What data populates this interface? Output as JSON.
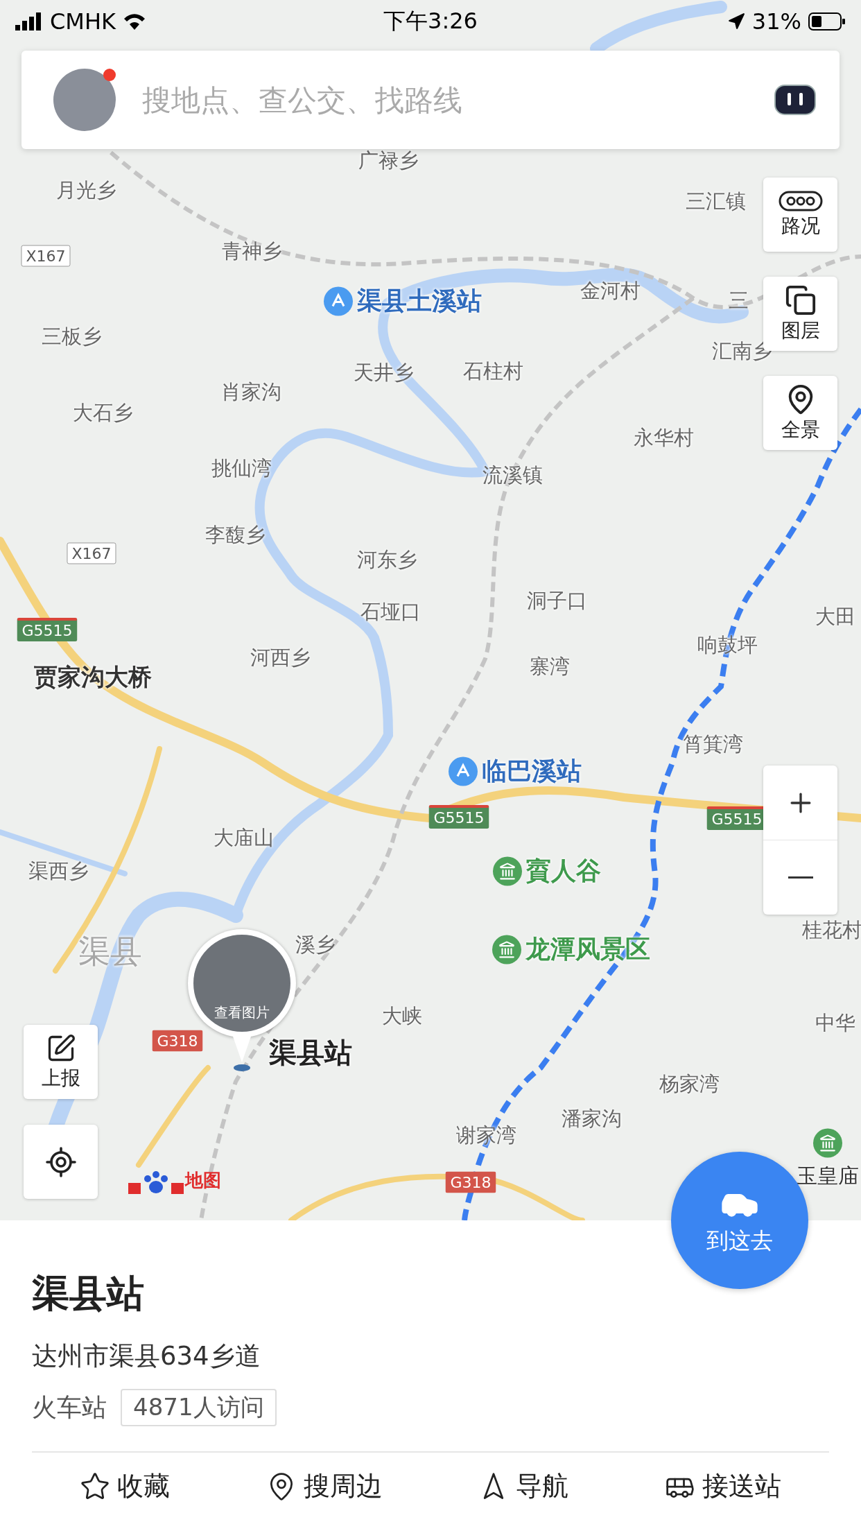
{
  "status_bar": {
    "carrier": "CMHK",
    "time": "下午3:26",
    "battery": "31%"
  },
  "search": {
    "placeholder": "搜地点、查公交、找路线",
    "badge": true
  },
  "map_labels": [
    {
      "text": "广禄乡",
      "kind": "place"
    },
    {
      "text": "月光乡",
      "kind": "place"
    },
    {
      "text": "三汇镇",
      "kind": "place"
    },
    {
      "text": "X167",
      "kind": "county_road"
    },
    {
      "text": "青神乡",
      "kind": "place"
    },
    {
      "text": "渠县土溪站",
      "kind": "station"
    },
    {
      "text": "金河村",
      "kind": "place"
    },
    {
      "text": "三",
      "kind": "place"
    },
    {
      "text": "汇南乡",
      "kind": "place"
    },
    {
      "text": "三板乡",
      "kind": "place"
    },
    {
      "text": "天井乡",
      "kind": "place"
    },
    {
      "text": "石柱村",
      "kind": "place"
    },
    {
      "text": "肖家沟",
      "kind": "place"
    },
    {
      "text": "大石乡",
      "kind": "place"
    },
    {
      "text": "永华村",
      "kind": "place"
    },
    {
      "text": "挑仙湾",
      "kind": "place"
    },
    {
      "text": "流溪镇",
      "kind": "place"
    },
    {
      "text": "李馥乡",
      "kind": "place"
    },
    {
      "text": "X167",
      "kind": "county_road"
    },
    {
      "text": "河东乡",
      "kind": "place"
    },
    {
      "text": "洞子口",
      "kind": "place"
    },
    {
      "text": "石垭口",
      "kind": "place"
    },
    {
      "text": "大田",
      "kind": "place"
    },
    {
      "text": "G5515",
      "kind": "expressway"
    },
    {
      "text": "响鼓坪",
      "kind": "place"
    },
    {
      "text": "河西乡",
      "kind": "place"
    },
    {
      "text": "寨湾",
      "kind": "place"
    },
    {
      "text": "贾家沟大桥",
      "kind": "landmark"
    },
    {
      "text": "筲箕湾",
      "kind": "place"
    },
    {
      "text": "临巴溪站",
      "kind": "station"
    },
    {
      "text": "G5515",
      "kind": "expressway"
    },
    {
      "text": "G5515",
      "kind": "expressway"
    },
    {
      "text": "大庙山",
      "kind": "place"
    },
    {
      "text": "渠西乡",
      "kind": "place"
    },
    {
      "text": "賨人谷",
      "kind": "scenic"
    },
    {
      "text": "渠县",
      "kind": "city"
    },
    {
      "text": "溪乡",
      "kind": "place"
    },
    {
      "text": "龙潭风景区",
      "kind": "scenic"
    },
    {
      "text": "桂花村",
      "kind": "place"
    },
    {
      "text": "大峡",
      "kind": "place"
    },
    {
      "text": "中华",
      "kind": "place"
    },
    {
      "text": "G318",
      "kind": "national_road"
    },
    {
      "text": "渠县站",
      "kind": "selected"
    },
    {
      "text": "杨家湾",
      "kind": "place"
    },
    {
      "text": "潘家沟",
      "kind": "place"
    },
    {
      "text": "谢家湾",
      "kind": "place"
    },
    {
      "text": "玉皇庙",
      "kind": "temple"
    },
    {
      "text": "G318",
      "kind": "national_road"
    }
  ],
  "photo_pin": {
    "caption": "查看图片"
  },
  "map_controls": [
    {
      "label": "路况",
      "kind": "traffic"
    },
    {
      "label": "图层",
      "kind": "layers"
    },
    {
      "label": "全景",
      "kind": "panorama"
    }
  ],
  "report_button": {
    "label": "上报"
  },
  "logo": {
    "text": "地图"
  },
  "go_button": {
    "label": "到这去"
  },
  "place": {
    "name": "渠县站",
    "address": "达州市渠县634乡道",
    "category": "火车站",
    "visits": "4871人访问"
  },
  "actions": [
    {
      "label": "收藏",
      "kind": "favorite"
    },
    {
      "label": "搜周边",
      "kind": "nearby"
    },
    {
      "label": "导航",
      "kind": "navigate"
    },
    {
      "label": "接送站",
      "kind": "pickup"
    }
  ]
}
